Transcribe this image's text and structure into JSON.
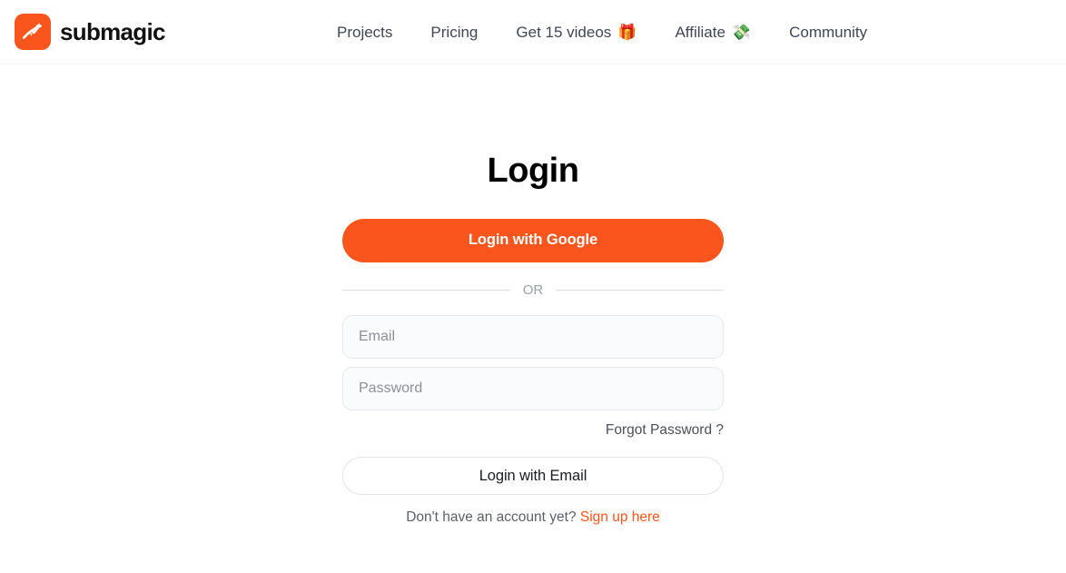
{
  "header": {
    "brand": {
      "name": "submagic",
      "icon": "magic-wand-icon",
      "mark_color": "#f9551d"
    },
    "nav": [
      {
        "label": "Projects",
        "emoji": ""
      },
      {
        "label": "Pricing",
        "emoji": ""
      },
      {
        "label": "Get 15 videos",
        "emoji": "🎁"
      },
      {
        "label": "Affiliate",
        "emoji": "💸"
      },
      {
        "label": "Community",
        "emoji": ""
      }
    ]
  },
  "login": {
    "title": "Login",
    "google_button": "Login with Google",
    "divider_label": "OR",
    "email_placeholder": "Email",
    "email_value": "",
    "password_placeholder": "Password",
    "password_value": "",
    "forgot_password": "Forgot Password ?",
    "email_button": "Login with Email",
    "signup_prompt": "Don't have an account yet?",
    "signup_link": "Sign up here",
    "accent_color": "#f9551d"
  }
}
